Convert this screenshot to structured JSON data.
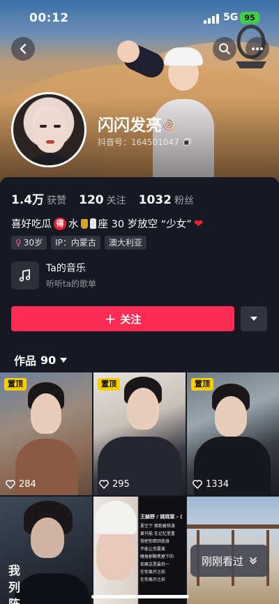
{
  "status_bar": {
    "time": "00:12",
    "network": "5G",
    "battery": "95"
  },
  "profile": {
    "nickname": "闪闪发亮",
    "nickname_emoji": "🍭",
    "douyin_id_label": "抖音号：",
    "douyin_id": "164501047"
  },
  "stats": [
    {
      "num": "1.4万",
      "label": "获赞"
    },
    {
      "num": "120",
      "label": "关注"
    },
    {
      "num": "1032",
      "label": "粉丝"
    }
  ],
  "bio": {
    "part1": "喜好吃瓜",
    "badge": "得",
    "part2": "水",
    "part3": "座 30 岁放空 “少女”",
    "heart": "❤"
  },
  "tags": [
    {
      "icon": "female-icon",
      "text": "30岁"
    },
    {
      "icon": "",
      "text": "IP：内蒙古"
    },
    {
      "icon": "",
      "text": "澳大利亚"
    }
  ],
  "music": {
    "title": "Ta的音乐",
    "subtitle": "听听ta的歌单"
  },
  "actions": {
    "follow_label": "关注",
    "follow_plus": "+"
  },
  "works": {
    "label": "作品",
    "count": "90"
  },
  "videos": [
    {
      "pinned": "置顶",
      "likes": "284"
    },
    {
      "pinned": "置顶",
      "likes": "295"
    },
    {
      "pinned": "置顶",
      "likes": "1334"
    },
    {
      "pinned": "",
      "likes": "",
      "caption": "我 列 阵"
    },
    {
      "pinned": "",
      "likes": "",
      "caption_title": "王赫野 / 姚晓棠 - (",
      "caption_lines": [
        "夏空下 拥抱着快演",
        "黄只能 在记忆里重",
        "想把你牵回我身",
        "不能让你要离",
        "曦角那颗黑屋下的",
        "如果这是最后一",
        "在你离开之前",
        "在你离开之前"
      ]
    },
    {
      "pinned": "",
      "likes": ""
    }
  ],
  "recent_label": "刚刚看过",
  "colors": {
    "accent": "#fe2c55",
    "bg": "#161823",
    "pin": "#facd00"
  }
}
